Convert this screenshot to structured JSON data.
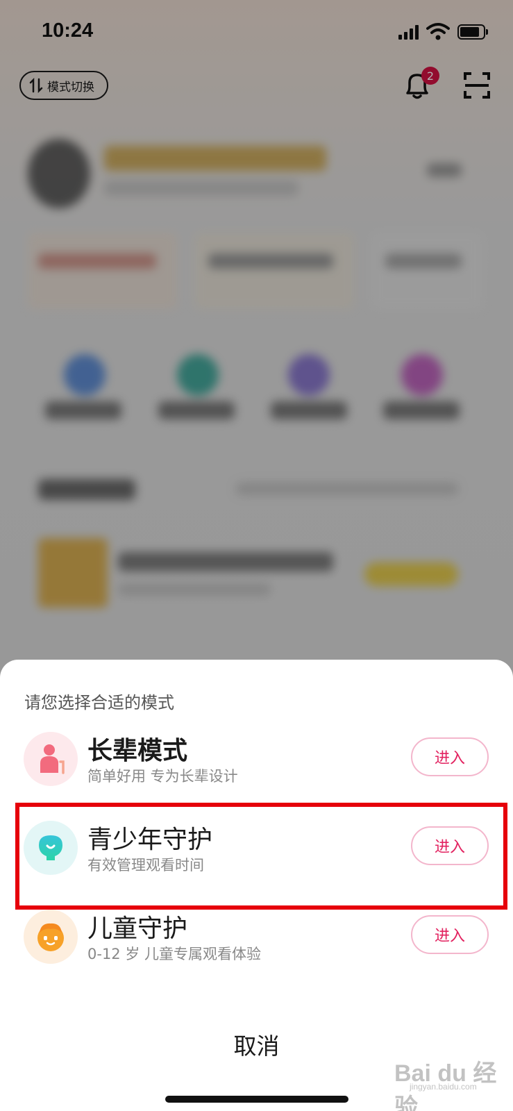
{
  "status_bar": {
    "time": "10:24"
  },
  "header": {
    "mode_switch_label": "模式切换",
    "notification_count": "2"
  },
  "sheet": {
    "title": "请您选择合适的模式",
    "modes": [
      {
        "name": "长辈模式",
        "desc": "简单好用 专为长辈设计",
        "button": "进入"
      },
      {
        "name": "青少年守护",
        "desc": "有效管理观看时间",
        "button": "进入"
      },
      {
        "name": "儿童守护",
        "desc": "0-12 岁 儿童专属观看体验",
        "button": "进入"
      }
    ],
    "cancel_label": "取消"
  },
  "watermark": {
    "main": "Bai du 经验",
    "sub": "jingyan.baidu.com"
  },
  "colors": {
    "accent": "#e2215f",
    "highlight": "#e6000b",
    "badge": "#d11243"
  }
}
